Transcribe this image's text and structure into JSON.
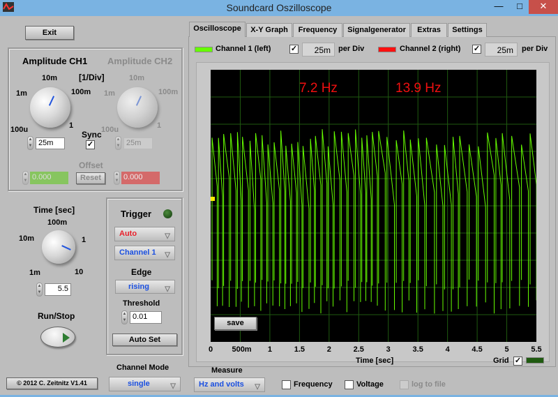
{
  "window": {
    "title": "Soundcard Oszilloscope",
    "minimize": "—",
    "maximize": "□",
    "close": "✕"
  },
  "left": {
    "exit": "Exit",
    "amp_ch1": "Amplitude CH1",
    "amp_ch2": "Amplitude CH2",
    "div_unit": "[1/Div]",
    "knob_labels": [
      "100u",
      "1m",
      "10m",
      "100m",
      "1"
    ],
    "ch1_value": "25m",
    "ch2_value": "25m",
    "sync": "Sync",
    "sync_checked": true,
    "offset": "Offset",
    "offset_ch1": "0.000",
    "offset_ch2": "0.000",
    "reset": "Reset",
    "time_title": "Time [sec]",
    "time_labels": [
      "1m",
      "10m",
      "100m",
      "1",
      "10"
    ],
    "time_value": "5.5",
    "run_stop": "Run/Stop",
    "copyright": "© 2012  C. Zeitnitz V1.41"
  },
  "trigger": {
    "title": "Trigger",
    "mode": "Auto",
    "channel": "Channel 1",
    "edge_label": "Edge",
    "edge": "rising",
    "threshold_label": "Threshold",
    "threshold": "0.01",
    "autoset": "Auto Set",
    "channel_mode_label": "Channel Mode",
    "channel_mode": "single"
  },
  "tabs": [
    "Oscilloscope",
    "X-Y Graph",
    "Frequency",
    "Signalgenerator",
    "Extras",
    "Settings"
  ],
  "channels": {
    "ch1": {
      "label": "Channel 1 (left)",
      "color": "#66ff00",
      "checked": true,
      "value": "25m",
      "per": "per Div"
    },
    "ch2": {
      "label": "Channel 2 (right)",
      "color": "#ff1010",
      "checked": true,
      "value": "25m",
      "per": "per Div"
    }
  },
  "scope": {
    "freq1": "7.2 Hz",
    "freq2": "13.9 Hz",
    "save": "save",
    "xlabel": "Time [sec]",
    "xticks": [
      "0",
      "500m",
      "1",
      "1.5",
      "2",
      "2.5",
      "3",
      "3.5",
      "4",
      "4.5",
      "5",
      "5.5"
    ],
    "grid_label": "Grid",
    "grid_checked": true,
    "grid_color": "#1f5a10"
  },
  "measure": {
    "label": "Measure",
    "mode": "Hz and volts",
    "frequency": "Frequency",
    "voltage": "Voltage",
    "log": "log to file"
  }
}
